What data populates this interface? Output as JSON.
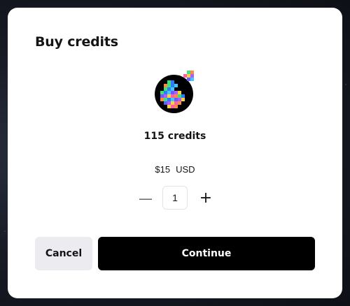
{
  "modal": {
    "title": "Buy credits",
    "package": {
      "credits_label": "115 credits",
      "price": "$15",
      "currency": "USD",
      "icon": "pixel-credits-logo"
    },
    "quantity": {
      "value": "1",
      "decrement_icon": "minus-icon",
      "increment_icon": "plus-icon"
    },
    "actions": {
      "cancel_label": "Cancel",
      "continue_label": "Continue"
    }
  },
  "colors": {
    "primary_button": "#000000",
    "secondary_button": "#ececf0",
    "modal_background": "#ffffff"
  }
}
